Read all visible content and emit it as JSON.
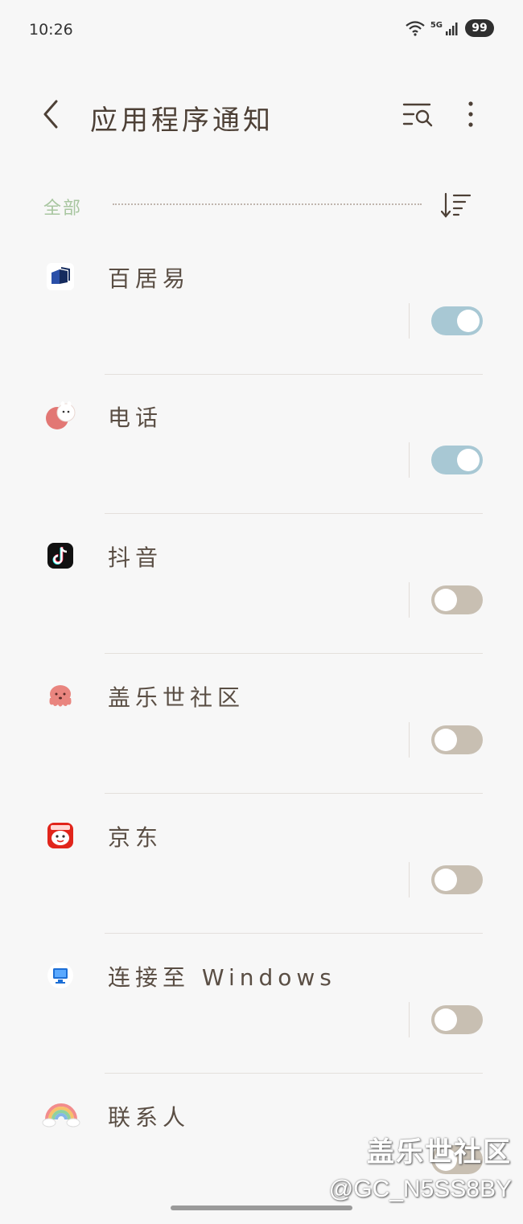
{
  "status_bar": {
    "time": "10:26",
    "network": "5G",
    "battery": "99"
  },
  "header": {
    "title": "应用程序通知",
    "icons": [
      "back-icon",
      "search-list-icon",
      "more-vert-icon"
    ]
  },
  "filter": {
    "label": "全部",
    "sort_icon": "sort-icon"
  },
  "apps": [
    {
      "name": "百居易",
      "enabled": true,
      "icon": "baijuyi-app-icon"
    },
    {
      "name": "电话",
      "enabled": true,
      "icon": "phone-app-icon"
    },
    {
      "name": "抖音",
      "enabled": false,
      "icon": "douyin-app-icon"
    },
    {
      "name": "盖乐世社区",
      "enabled": false,
      "icon": "galaxy-community-app-icon"
    },
    {
      "name": "京东",
      "enabled": false,
      "icon": "jd-app-icon"
    },
    {
      "name": "连接至 Windows",
      "enabled": false,
      "icon": "link-to-windows-app-icon"
    },
    {
      "name": "联系人",
      "enabled": false,
      "icon": "contacts-app-icon"
    }
  ],
  "watermark": {
    "line1": "盖乐世社区",
    "line2": "@GC_N5SS8BY"
  },
  "colors": {
    "background": "#f7f7f7",
    "toggle_on": "#a8c8d4",
    "toggle_off": "#c8bfb2",
    "accent_label": "#a8c6a0"
  }
}
